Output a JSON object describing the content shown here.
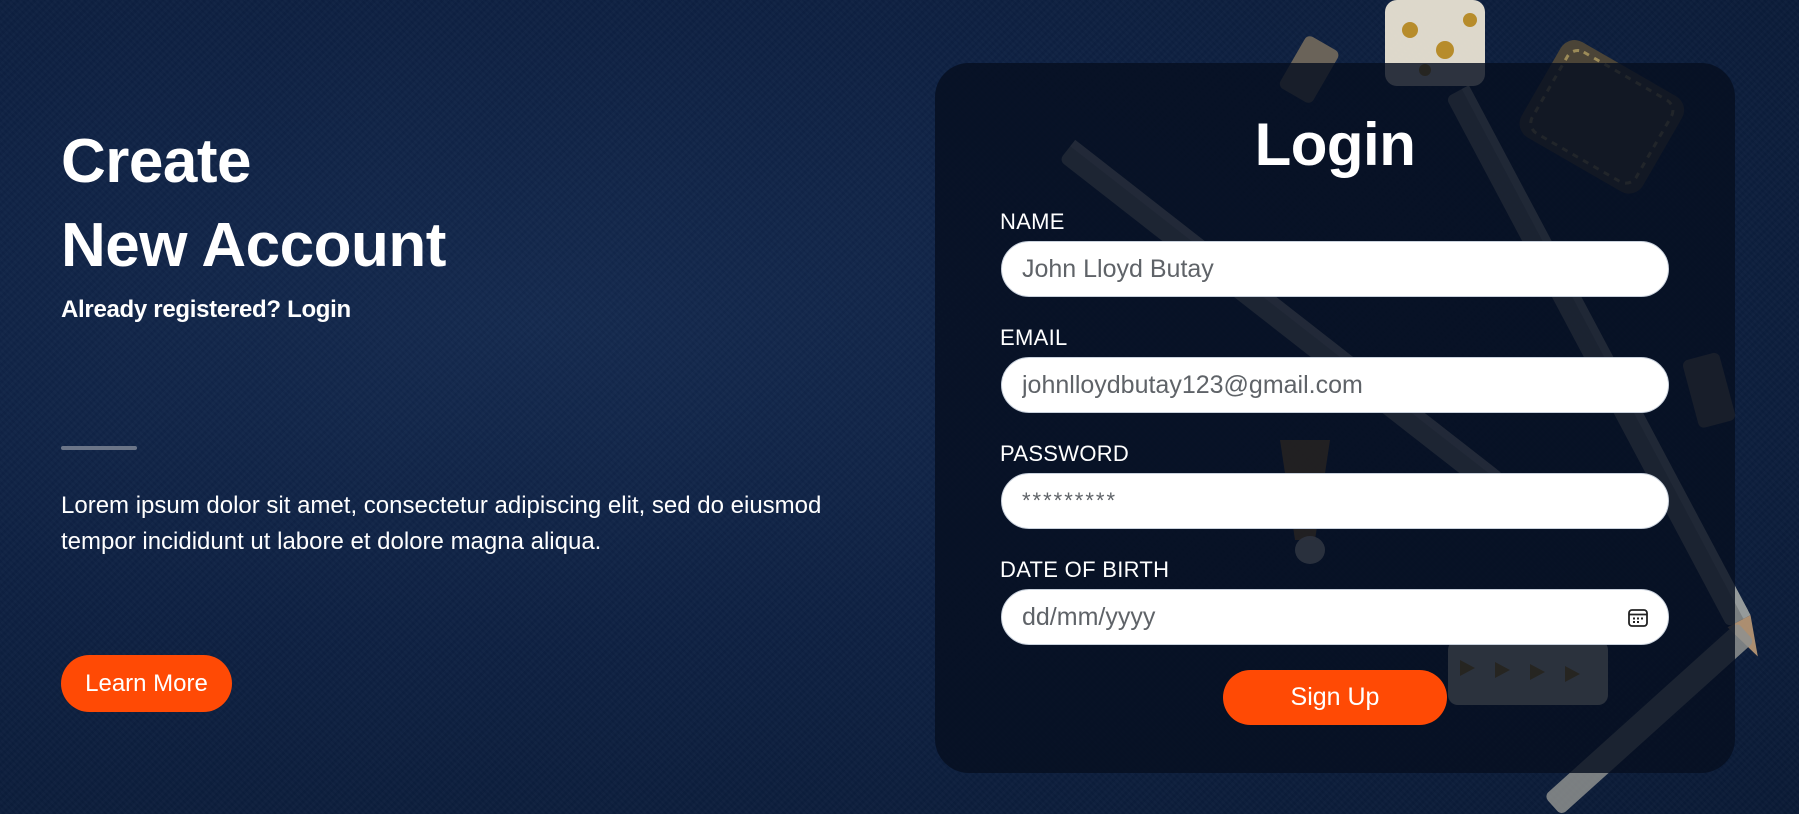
{
  "hero": {
    "title_line1": "Create",
    "title_line2": "New Account",
    "subtitle": "Already registered? Login",
    "body": "Lorem ipsum dolor sit amet, consectetur adipiscing elit, sed do eiusmod tempor incididunt ut labore et dolore magna aliqua.",
    "cta_label": "Learn More"
  },
  "login": {
    "title": "Login",
    "fields": [
      {
        "label": "NAME",
        "value": "John Lloyd Butay",
        "placeholder": ""
      },
      {
        "label": "EMAIL",
        "value": "johnlloydbutay123@gmail.com",
        "placeholder": ""
      },
      {
        "label": "PASSWORD",
        "value": "*********",
        "placeholder": ""
      },
      {
        "label": "DATE OF BIRTH",
        "value": "",
        "placeholder": "dd/mm/yyyy",
        "icon": "calendar-icon"
      }
    ],
    "submit_label": "Sign Up"
  },
  "colors": {
    "accent": "#ff4a05",
    "background": "#0e2143",
    "card": "#060f20"
  }
}
